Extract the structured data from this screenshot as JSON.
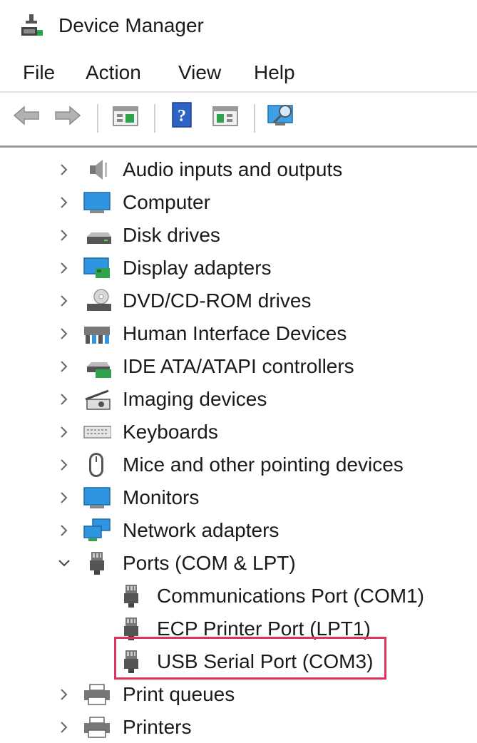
{
  "window": {
    "title": "Device Manager"
  },
  "menu": [
    "File",
    "Action",
    "View",
    "Help"
  ],
  "toolbar": {
    "buttons": [
      "back-icon",
      "forward-icon",
      "properties-icon",
      "help-icon",
      "update-driver-icon",
      "scan-hardware-icon"
    ]
  },
  "tree": {
    "nodes": [
      {
        "label": "Audio inputs and outputs",
        "icon": "speaker-icon",
        "expanded": false
      },
      {
        "label": "Computer",
        "icon": "computer-icon",
        "expanded": false
      },
      {
        "label": "Disk drives",
        "icon": "disk-drive-icon",
        "expanded": false
      },
      {
        "label": "Display adapters",
        "icon": "display-adapter-icon",
        "expanded": false
      },
      {
        "label": "DVD/CD-ROM drives",
        "icon": "dvd-drive-icon",
        "expanded": false
      },
      {
        "label": "Human Interface Devices",
        "icon": "hid-icon",
        "expanded": false
      },
      {
        "label": "IDE ATA/ATAPI controllers",
        "icon": "ide-controller-icon",
        "expanded": false
      },
      {
        "label": "Imaging devices",
        "icon": "camera-icon",
        "expanded": false
      },
      {
        "label": "Keyboards",
        "icon": "keyboard-icon",
        "expanded": false
      },
      {
        "label": "Mice and other pointing devices",
        "icon": "mouse-icon",
        "expanded": false
      },
      {
        "label": "Monitors",
        "icon": "monitor-icon",
        "expanded": false
      },
      {
        "label": "Network adapters",
        "icon": "network-icon",
        "expanded": false
      },
      {
        "label": "Ports (COM & LPT)",
        "icon": "port-icon",
        "expanded": true
      },
      {
        "label": "Communications Port (COM1)",
        "icon": "port-icon",
        "child": true
      },
      {
        "label": "ECP Printer Port (LPT1)",
        "icon": "port-icon",
        "child": true
      },
      {
        "label": "USB Serial Port (COM3)",
        "icon": "port-icon",
        "child": true,
        "highlighted": true
      },
      {
        "label": "Print queues",
        "icon": "printer-icon",
        "expanded": false
      },
      {
        "label": "Printers",
        "icon": "printer-icon",
        "expanded": false
      }
    ]
  },
  "colors": {
    "highlight": "#e0315f",
    "icon_blue": "#1e88d6",
    "chevron": "#666666"
  }
}
